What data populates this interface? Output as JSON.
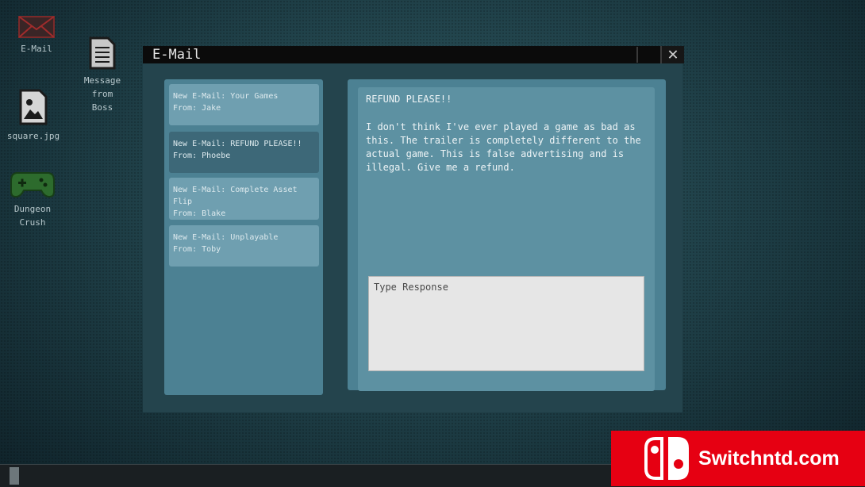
{
  "desktop": {
    "icons": [
      {
        "label": "E-Mail",
        "icon": "envelope-icon"
      },
      {
        "label": "Message\nfrom\nBoss",
        "icon": "document-icon"
      },
      {
        "label": "square.jpg",
        "icon": "image-file-icon"
      },
      {
        "label": "Dungeon\nCrush",
        "icon": "gamepad-icon"
      }
    ]
  },
  "window": {
    "title": "E-Mail",
    "close_label": "✕"
  },
  "inbox": {
    "emails": [
      {
        "subject": "New E-Mail: Your Games",
        "from": "From: Jake"
      },
      {
        "subject": "New E-Mail: REFUND PLEASE!!",
        "from": "From: Phoebe",
        "active": true
      },
      {
        "subject": "New E-Mail: Complete Asset Flip",
        "from": "From: Blake"
      },
      {
        "subject": "New E-Mail: Unplayable",
        "from": "From: Toby"
      }
    ]
  },
  "reader": {
    "title": "REFUND PLEASE!!",
    "body": "I don't think I've ever played a game as bad as this. The trailer is completely different to the actual game. This is false advertising and is illegal. Give me a refund.",
    "response_placeholder": "Type Response"
  },
  "watermark": {
    "text": "Switchntd.com"
  },
  "colors": {
    "brand_red": "#e60012",
    "panel": "#4c8193",
    "item": "#6f9fb0",
    "item_active": "#3d6878"
  }
}
